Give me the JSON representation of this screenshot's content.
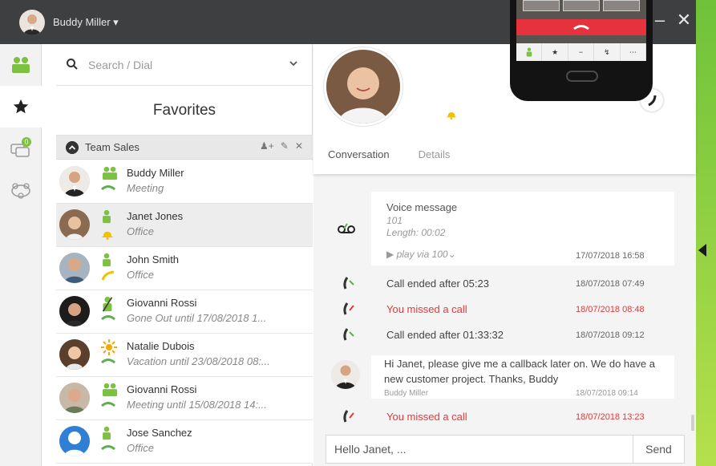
{
  "titlebar": {
    "user_name": "Buddy Miller ▾",
    "minimize": "–",
    "close": "✕"
  },
  "rail": {
    "items": [
      "contacts-icon",
      "star-icon",
      "chat-icon",
      "meeting-icon"
    ],
    "chat_badge": "0"
  },
  "search": {
    "placeholder": "Search / Dial"
  },
  "favorites_label": "Favorites",
  "group": {
    "name": "Team Sales"
  },
  "contacts": [
    {
      "name": "Buddy Miller",
      "status": "Meeting",
      "presence": "green",
      "phone": "green",
      "selected": false
    },
    {
      "name": "Janet Jones",
      "status": "Office",
      "presence": "green",
      "phone": "yellow-bell",
      "selected": true
    },
    {
      "name": "John Smith",
      "status": "Office",
      "presence": "green",
      "phone": "yellow",
      "selected": false
    },
    {
      "name": "Giovanni Rossi",
      "status": "Gone Out until 17/08/2018 1...",
      "presence": "slashed",
      "phone": "green",
      "selected": false
    },
    {
      "name": "Natalie Dubois",
      "status": "Vacation until 23/08/2018 08:...",
      "presence": "sun",
      "phone": "green",
      "selected": false
    },
    {
      "name": "Giovanni Rossi",
      "status": "Meeting until 15/08/2018 14:...",
      "presence": "group",
      "phone": "green",
      "selected": false
    },
    {
      "name": "Jose Sanchez",
      "status": "Office",
      "presence": "green",
      "phone": "green",
      "selected": false
    }
  ],
  "conversation": {
    "tabs": [
      "Conversation",
      "Details"
    ],
    "voice_message": {
      "title": "Voice message",
      "ext": "101",
      "length": "Length: 00:02",
      "play": "▶ play via 100⌄",
      "time": "17/07/2018 16:58"
    },
    "events": [
      {
        "text": "Call ended after 05:23",
        "time": "18/07/2018 07:49",
        "missed": false
      },
      {
        "text": "You missed a call",
        "time": "18/07/2018 08:48",
        "missed": true
      },
      {
        "text": "Call ended after 01:33:32",
        "time": "18/07/2018 09:12",
        "missed": false
      }
    ],
    "message": {
      "text": "Hi Janet, please give me a callback later on. We do have a new customer project. Thanks, Buddy",
      "author": "Buddy Miller",
      "time": "18/07/2018 09:14"
    },
    "last_event": {
      "text": "You missed a call",
      "time": "18/07/2018 13:23",
      "missed": true
    },
    "composer_value": "Hello Janet, ...",
    "send_label": "Send"
  },
  "colors": {
    "titlebar": "#3d3f40",
    "accent_green": "#6fc23a",
    "missed_red": "#e03a3a",
    "presence_yellow": "#f2c200"
  }
}
